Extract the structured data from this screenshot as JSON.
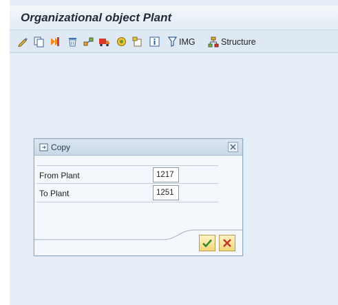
{
  "window": {
    "title": "Organizational object Plant"
  },
  "toolbar": {
    "items": [
      {
        "icon": "edit-icon"
      },
      {
        "icon": "copy-icon"
      },
      {
        "icon": "copy-as-icon"
      },
      {
        "icon": "delete-icon"
      },
      {
        "icon": "transport-icon"
      },
      {
        "icon": "truck-icon"
      },
      {
        "icon": "check-icon"
      },
      {
        "icon": "attach-icon"
      },
      {
        "icon": "info-icon"
      }
    ],
    "img_label": "IMG",
    "structure_label": "Structure"
  },
  "dialog": {
    "title": "Copy",
    "fields": [
      {
        "label": "From Plant",
        "value": "1217"
      },
      {
        "label": "To Plant",
        "value": "1251"
      }
    ],
    "confirm_icon": "checkmark-icon",
    "cancel_icon": "cancel-x-icon"
  },
  "colors": {
    "background": "#e5eef7",
    "confirm": "#2e8b2e",
    "cancel": "#c0392b"
  }
}
